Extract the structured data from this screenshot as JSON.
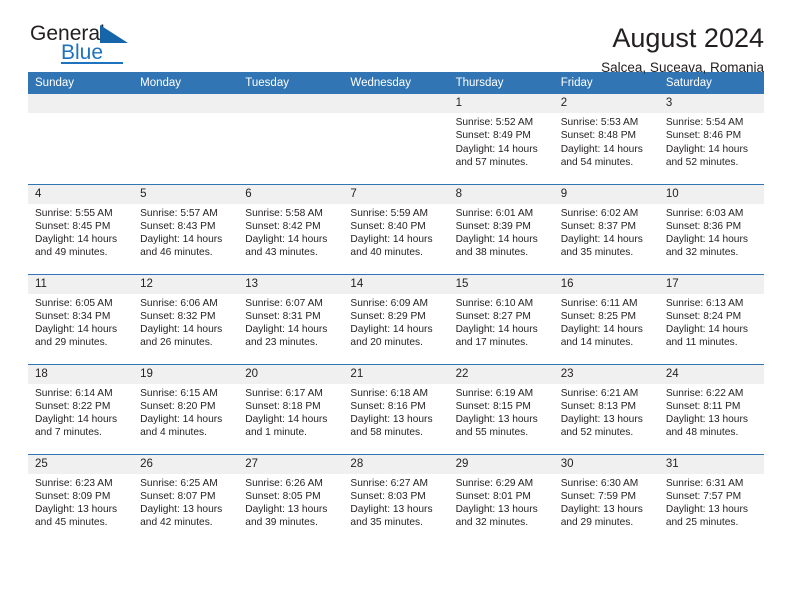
{
  "logo": {
    "word_top": "General",
    "word_bottom": "Blue",
    "triangle_color": "#1565a8",
    "blue_color": "#1e73be"
  },
  "header": {
    "title": "August 2024",
    "subtitle": "Salcea, Suceava, Romania"
  },
  "theme": {
    "header_blue": "#3175b4",
    "daynum_bg": "#f0f0f0"
  },
  "weekdays": [
    "Sunday",
    "Monday",
    "Tuesday",
    "Wednesday",
    "Thursday",
    "Friday",
    "Saturday"
  ],
  "labels": {
    "sunrise": "Sunrise:",
    "sunset": "Sunset:",
    "daylight": "Daylight:"
  },
  "weeks": [
    [
      {
        "day": "",
        "blank": true
      },
      {
        "day": "",
        "blank": true
      },
      {
        "day": "",
        "blank": true
      },
      {
        "day": "",
        "blank": true
      },
      {
        "day": "1",
        "sunrise": "Sunrise: 5:52 AM",
        "sunset": "Sunset: 8:49 PM",
        "daylight_1": "Daylight: 14 hours",
        "daylight_2": "and 57 minutes."
      },
      {
        "day": "2",
        "sunrise": "Sunrise: 5:53 AM",
        "sunset": "Sunset: 8:48 PM",
        "daylight_1": "Daylight: 14 hours",
        "daylight_2": "and 54 minutes."
      },
      {
        "day": "3",
        "sunrise": "Sunrise: 5:54 AM",
        "sunset": "Sunset: 8:46 PM",
        "daylight_1": "Daylight: 14 hours",
        "daylight_2": "and 52 minutes."
      }
    ],
    [
      {
        "day": "4",
        "sunrise": "Sunrise: 5:55 AM",
        "sunset": "Sunset: 8:45 PM",
        "daylight_1": "Daylight: 14 hours",
        "daylight_2": "and 49 minutes."
      },
      {
        "day": "5",
        "sunrise": "Sunrise: 5:57 AM",
        "sunset": "Sunset: 8:43 PM",
        "daylight_1": "Daylight: 14 hours",
        "daylight_2": "and 46 minutes."
      },
      {
        "day": "6",
        "sunrise": "Sunrise: 5:58 AM",
        "sunset": "Sunset: 8:42 PM",
        "daylight_1": "Daylight: 14 hours",
        "daylight_2": "and 43 minutes."
      },
      {
        "day": "7",
        "sunrise": "Sunrise: 5:59 AM",
        "sunset": "Sunset: 8:40 PM",
        "daylight_1": "Daylight: 14 hours",
        "daylight_2": "and 40 minutes."
      },
      {
        "day": "8",
        "sunrise": "Sunrise: 6:01 AM",
        "sunset": "Sunset: 8:39 PM",
        "daylight_1": "Daylight: 14 hours",
        "daylight_2": "and 38 minutes."
      },
      {
        "day": "9",
        "sunrise": "Sunrise: 6:02 AM",
        "sunset": "Sunset: 8:37 PM",
        "daylight_1": "Daylight: 14 hours",
        "daylight_2": "and 35 minutes."
      },
      {
        "day": "10",
        "sunrise": "Sunrise: 6:03 AM",
        "sunset": "Sunset: 8:36 PM",
        "daylight_1": "Daylight: 14 hours",
        "daylight_2": "and 32 minutes."
      }
    ],
    [
      {
        "day": "11",
        "sunrise": "Sunrise: 6:05 AM",
        "sunset": "Sunset: 8:34 PM",
        "daylight_1": "Daylight: 14 hours",
        "daylight_2": "and 29 minutes."
      },
      {
        "day": "12",
        "sunrise": "Sunrise: 6:06 AM",
        "sunset": "Sunset: 8:32 PM",
        "daylight_1": "Daylight: 14 hours",
        "daylight_2": "and 26 minutes."
      },
      {
        "day": "13",
        "sunrise": "Sunrise: 6:07 AM",
        "sunset": "Sunset: 8:31 PM",
        "daylight_1": "Daylight: 14 hours",
        "daylight_2": "and 23 minutes."
      },
      {
        "day": "14",
        "sunrise": "Sunrise: 6:09 AM",
        "sunset": "Sunset: 8:29 PM",
        "daylight_1": "Daylight: 14 hours",
        "daylight_2": "and 20 minutes."
      },
      {
        "day": "15",
        "sunrise": "Sunrise: 6:10 AM",
        "sunset": "Sunset: 8:27 PM",
        "daylight_1": "Daylight: 14 hours",
        "daylight_2": "and 17 minutes."
      },
      {
        "day": "16",
        "sunrise": "Sunrise: 6:11 AM",
        "sunset": "Sunset: 8:25 PM",
        "daylight_1": "Daylight: 14 hours",
        "daylight_2": "and 14 minutes."
      },
      {
        "day": "17",
        "sunrise": "Sunrise: 6:13 AM",
        "sunset": "Sunset: 8:24 PM",
        "daylight_1": "Daylight: 14 hours",
        "daylight_2": "and 11 minutes."
      }
    ],
    [
      {
        "day": "18",
        "sunrise": "Sunrise: 6:14 AM",
        "sunset": "Sunset: 8:22 PM",
        "daylight_1": "Daylight: 14 hours",
        "daylight_2": "and 7 minutes."
      },
      {
        "day": "19",
        "sunrise": "Sunrise: 6:15 AM",
        "sunset": "Sunset: 8:20 PM",
        "daylight_1": "Daylight: 14 hours",
        "daylight_2": "and 4 minutes."
      },
      {
        "day": "20",
        "sunrise": "Sunrise: 6:17 AM",
        "sunset": "Sunset: 8:18 PM",
        "daylight_1": "Daylight: 14 hours",
        "daylight_2": "and 1 minute."
      },
      {
        "day": "21",
        "sunrise": "Sunrise: 6:18 AM",
        "sunset": "Sunset: 8:16 PM",
        "daylight_1": "Daylight: 13 hours",
        "daylight_2": "and 58 minutes."
      },
      {
        "day": "22",
        "sunrise": "Sunrise: 6:19 AM",
        "sunset": "Sunset: 8:15 PM",
        "daylight_1": "Daylight: 13 hours",
        "daylight_2": "and 55 minutes."
      },
      {
        "day": "23",
        "sunrise": "Sunrise: 6:21 AM",
        "sunset": "Sunset: 8:13 PM",
        "daylight_1": "Daylight: 13 hours",
        "daylight_2": "and 52 minutes."
      },
      {
        "day": "24",
        "sunrise": "Sunrise: 6:22 AM",
        "sunset": "Sunset: 8:11 PM",
        "daylight_1": "Daylight: 13 hours",
        "daylight_2": "and 48 minutes."
      }
    ],
    [
      {
        "day": "25",
        "sunrise": "Sunrise: 6:23 AM",
        "sunset": "Sunset: 8:09 PM",
        "daylight_1": "Daylight: 13 hours",
        "daylight_2": "and 45 minutes."
      },
      {
        "day": "26",
        "sunrise": "Sunrise: 6:25 AM",
        "sunset": "Sunset: 8:07 PM",
        "daylight_1": "Daylight: 13 hours",
        "daylight_2": "and 42 minutes."
      },
      {
        "day": "27",
        "sunrise": "Sunrise: 6:26 AM",
        "sunset": "Sunset: 8:05 PM",
        "daylight_1": "Daylight: 13 hours",
        "daylight_2": "and 39 minutes."
      },
      {
        "day": "28",
        "sunrise": "Sunrise: 6:27 AM",
        "sunset": "Sunset: 8:03 PM",
        "daylight_1": "Daylight: 13 hours",
        "daylight_2": "and 35 minutes."
      },
      {
        "day": "29",
        "sunrise": "Sunrise: 6:29 AM",
        "sunset": "Sunset: 8:01 PM",
        "daylight_1": "Daylight: 13 hours",
        "daylight_2": "and 32 minutes."
      },
      {
        "day": "30",
        "sunrise": "Sunrise: 6:30 AM",
        "sunset": "Sunset: 7:59 PM",
        "daylight_1": "Daylight: 13 hours",
        "daylight_2": "and 29 minutes."
      },
      {
        "day": "31",
        "sunrise": "Sunrise: 6:31 AM",
        "sunset": "Sunset: 7:57 PM",
        "daylight_1": "Daylight: 13 hours",
        "daylight_2": "and 25 minutes."
      }
    ]
  ]
}
